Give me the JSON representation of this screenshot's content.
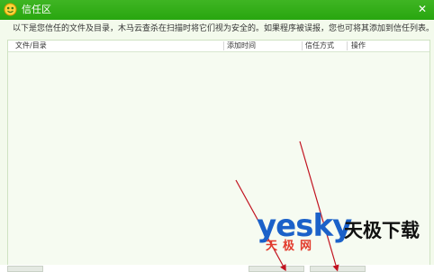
{
  "window": {
    "title": "信任区",
    "close_symbol": "✕"
  },
  "notice": {
    "text": "以下是您信任的文件及目录，木马云查杀在扫描时将它们视为安全的。如果程序被误报，您也可将其添加到信任列表。"
  },
  "table": {
    "columns": [
      {
        "label": "文件/目录"
      },
      {
        "label": "添加时间"
      },
      {
        "label": "信任方式"
      },
      {
        "label": "操作"
      }
    ]
  },
  "watermark": {
    "logo_text": "yesky",
    "logo_cn": "天极网",
    "brand_text": "天极下载"
  },
  "colors": {
    "titlebar": "#2fae18",
    "background": "#f3faec",
    "arrow": "#c1121f",
    "watermark_blue": "#1b61c9",
    "watermark_red": "#e23b2c"
  },
  "icons": {
    "title_icon": "trust-shield-icon",
    "close_icon": "close-icon"
  }
}
